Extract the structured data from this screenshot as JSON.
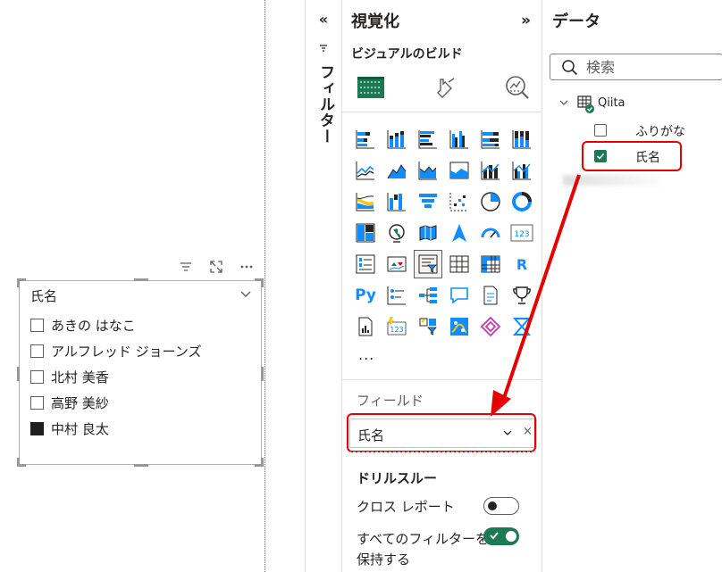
{
  "slicer": {
    "title": "氏名",
    "items": [
      {
        "label": "あきの はなこ",
        "checked": false
      },
      {
        "label": "アルフレッド ジョーンズ",
        "checked": false
      },
      {
        "label": "北村 美香",
        "checked": false
      },
      {
        "label": "高野 美紗",
        "checked": false
      },
      {
        "label": "中村 良太",
        "checked": true
      }
    ],
    "header_icons": [
      "filter-lines-icon",
      "focus-mode-icon",
      "more-options-icon"
    ]
  },
  "filter_pane": {
    "collapse_glyph": "«",
    "label": "フィルター"
  },
  "visualizations": {
    "title": "視覚化",
    "expand_glyph": "»",
    "subtitle": "ビジュアルのビルド",
    "modes": [
      "build-visual-icon",
      "format-visual-icon",
      "analytics-icon"
    ],
    "grid": [
      [
        "stacked-bar-chart-icon",
        "stacked-column-chart-icon",
        "clustered-bar-chart-icon",
        "clustered-column-chart-icon",
        "100-stacked-bar-chart-icon",
        "100-stacked-column-chart-icon"
      ],
      [
        "line-chart-icon",
        "area-chart-icon",
        "stacked-area-chart-icon",
        "100-stacked-area-chart-icon",
        "line-and-stacked-column-chart-icon",
        "line-and-clustered-column-chart-icon"
      ],
      [
        "ribbon-chart-icon",
        "waterfall-chart-icon",
        "funnel-chart-icon",
        "scatter-chart-icon",
        "pie-chart-icon",
        "donut-chart-icon"
      ],
      [
        "treemap-icon",
        "map-icon",
        "filled-map-icon",
        "azure-map-icon",
        "gauge-icon",
        "card-icon"
      ],
      [
        "multi-row-card-icon",
        "kpi-icon",
        "slicer-icon",
        "table-icon",
        "matrix-icon",
        "r-script-visual-icon"
      ],
      [
        "python-visual-icon",
        "key-influencers-icon",
        "decomposition-tree-icon",
        "qa-icon",
        "smart-narrative-icon",
        "metrics-icon"
      ],
      [
        "paginated-report-icon",
        "power-apps-icon",
        "power-automate-icon",
        "arcgis-map-icon",
        "power-apps-diamond-icon",
        "narrative-hourglass-icon"
      ]
    ],
    "grid_text": {
      "card": "123",
      "r": "R",
      "py": "Py",
      "small123": "123"
    },
    "more": "...",
    "fields_label": "フィールド",
    "field_well_value": "氏名",
    "field_well_close": "×",
    "drill_title": "ドリルスルー",
    "cross_report_label": "クロス レポート",
    "cross_report_on": false,
    "keep_filters_label": "すべてのフィルターを保持する",
    "keep_filters_on": true
  },
  "data": {
    "title": "データ",
    "search_placeholder": "検索",
    "table_name": "Qiita",
    "fields": [
      {
        "label": "ふりがな",
        "checked": false
      },
      {
        "label": "氏名",
        "checked": true
      }
    ]
  },
  "colors": {
    "accent_green": "#1b7a53",
    "highlight_red": "#e60000",
    "icon_blue": "#118dff",
    "icon_dark": "#252423"
  }
}
